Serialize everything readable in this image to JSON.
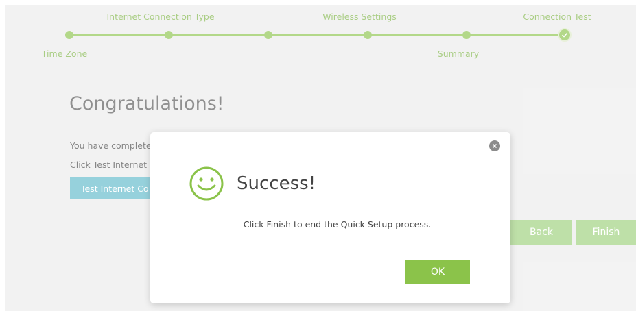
{
  "steps": {
    "time_zone": "Time Zone",
    "internet_connection_type": "Internet Connection Type",
    "wireless_settings": "Wireless Settings",
    "summary": "Summary",
    "connection_test": "Connection Test"
  },
  "main": {
    "title": "Congratulations!",
    "line1": "You have complete",
    "line2": "Click Test Internet",
    "test_button": "Test Internet Co",
    "back_button": "Back",
    "finish_button": "Finish"
  },
  "modal": {
    "title": "Success!",
    "message": "Click Finish to end the Quick Setup process.",
    "ok_button": "OK",
    "close_icon": "close-icon",
    "status_icon": "smiley-icon"
  },
  "colors": {
    "accent_green": "#8bc34a",
    "button_light_green": "#9bd07a",
    "test_button_teal": "#5fb8c9"
  }
}
